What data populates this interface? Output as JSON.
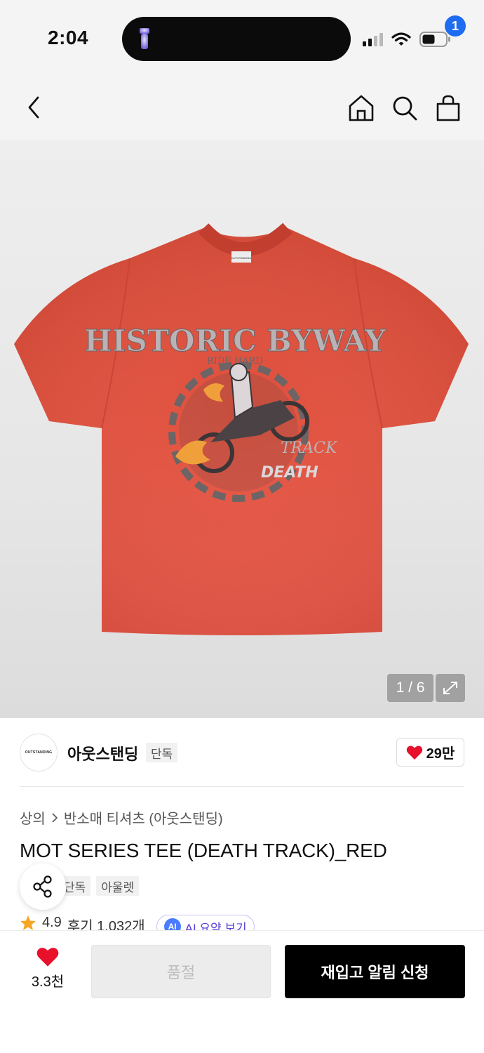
{
  "status_bar": {
    "time": "2:04",
    "icons": [
      "flashlight-icon",
      "signal-icon",
      "wifi-icon",
      "battery-icon"
    ]
  },
  "nav": {
    "back_icon": "chevron-left-icon",
    "home_icon": "home-icon",
    "search_icon": "search-icon",
    "cart_icon": "shopping-bag-icon",
    "cart_badge": "1"
  },
  "gallery": {
    "counter": "1 / 6",
    "expand_icon": "expand-icon",
    "print_title": "HISTORIC BYWAY",
    "print_sub": "RIDE HARD",
    "print_track": "TRACK",
    "print_death": "DEATH",
    "neck_label": "OUTSTANDING"
  },
  "brand": {
    "logo_text": "OUTSTANDING",
    "name": "아웃스탠딩",
    "tag": "단독",
    "likes": "29만"
  },
  "product": {
    "breadcrumb": [
      "상의",
      "반소매 티셔츠 (아웃스탠딩)"
    ],
    "title": "MOT SERIES TEE (DEATH TRACK)_RED",
    "tags": [
      "단독",
      "아울렛"
    ],
    "rating": "4.9",
    "reviews": "후기 1,032개",
    "ai_badge": "AI",
    "ai_summary": "AI 요약 보기"
  },
  "bottom_bar": {
    "like_count": "3.3천",
    "soldout_label": "품절",
    "restock_label": "재입고 알림 신청"
  },
  "colors": {
    "accent": "#1f6cf0",
    "heart": "#e8102a",
    "shirt": "#e0523f",
    "primary_button": "#000000"
  }
}
